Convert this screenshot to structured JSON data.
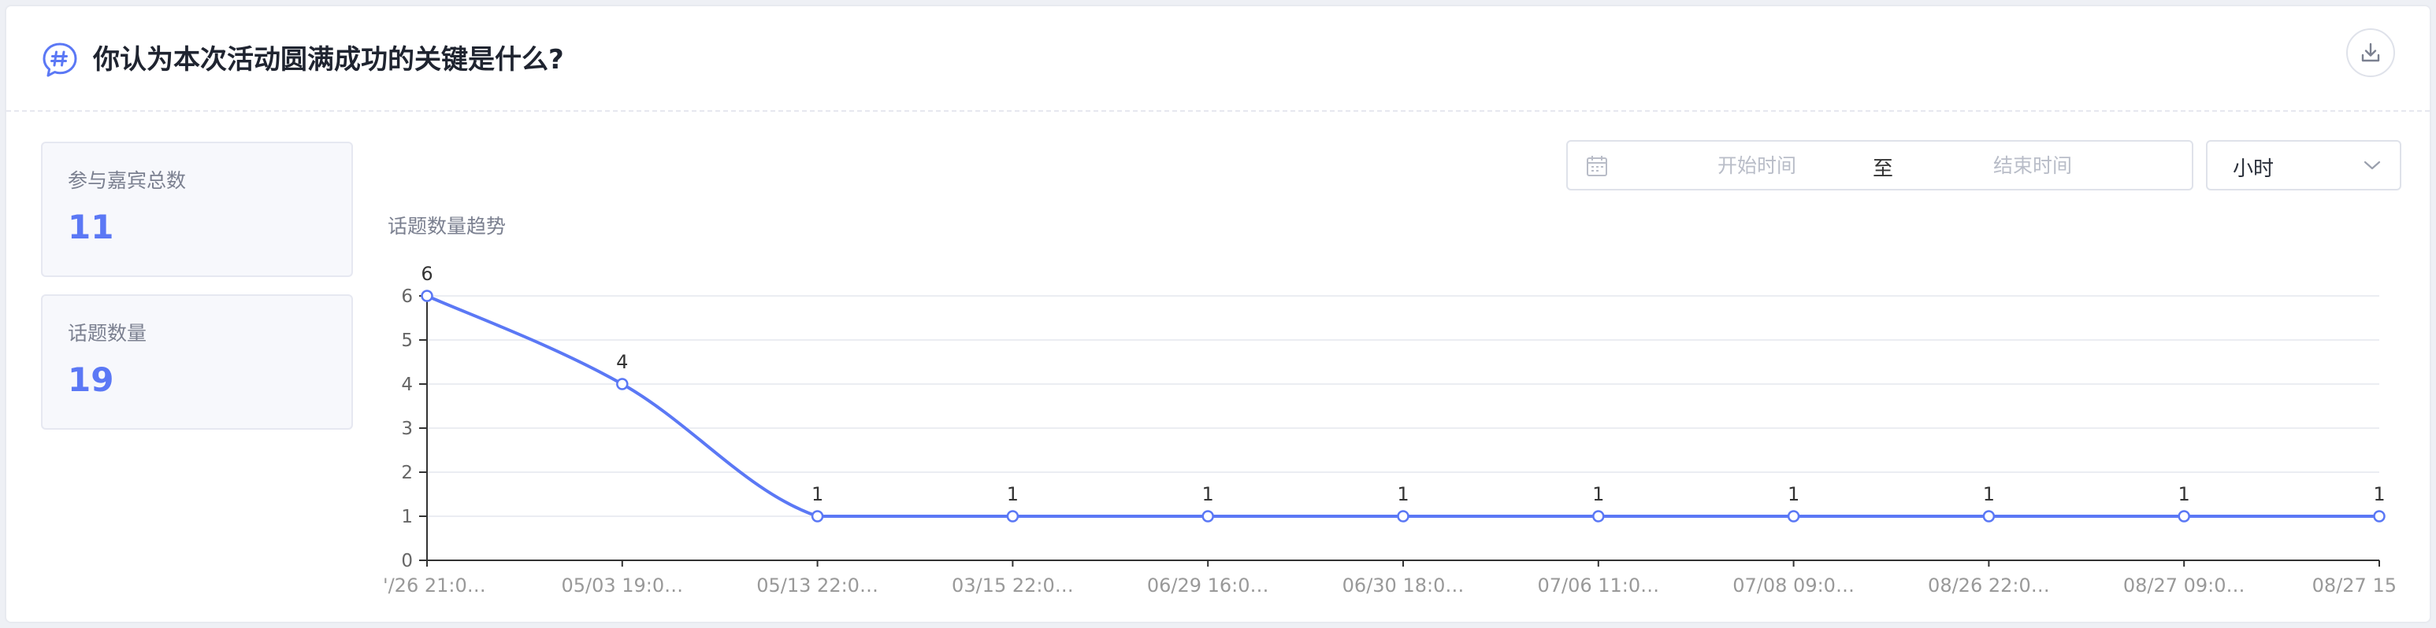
{
  "header": {
    "title": "你认为本次活动圆满成功的关键是什么?",
    "topic_icon": "hashtag-chat-icon",
    "download_icon": "download-icon"
  },
  "stats": [
    {
      "label": "参与嘉宾总数",
      "value": "11"
    },
    {
      "label": "话题数量",
      "value": "19"
    }
  ],
  "filters": {
    "calendar_icon": "calendar-icon",
    "start_placeholder": "开始时间",
    "separator": "至",
    "end_placeholder": "结束时间",
    "granularity": "小时",
    "chevron_icon": "chevron-down-icon"
  },
  "chart_data": {
    "type": "line",
    "title": "话题数量趋势",
    "categories": [
      "'/26 21:0…",
      "05/03 19:0…",
      "05/13 22:0…",
      "03/15 22:0…",
      "06/29 16:0…",
      "06/30 18:0…",
      "07/06 11:0…",
      "07/08 09:0…",
      "08/26 22:0…",
      "08/27 09:0…",
      "08/27 15"
    ],
    "series": [
      {
        "values": [
          6,
          4,
          1,
          1,
          1,
          1,
          1,
          1,
          1,
          1,
          1
        ]
      }
    ],
    "ylim": [
      0,
      6
    ],
    "yticks": [
      0,
      1,
      2,
      3,
      4,
      5,
      6
    ],
    "grid": true,
    "data_labels": true,
    "smooth": true,
    "colors": {
      "line": "#5b78f5",
      "grid": "#ebedf2",
      "axis": "#333333",
      "label": "#999999"
    }
  }
}
